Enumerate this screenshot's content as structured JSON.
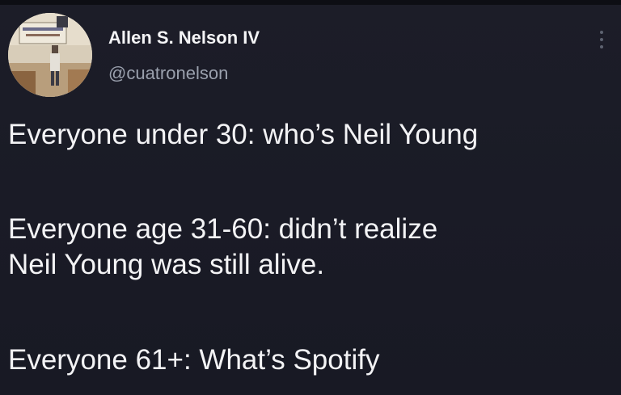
{
  "tweet": {
    "author_name": "Allen S. Nelson IV",
    "author_handle": "@cuatronelson",
    "avatar_icon": "profile-photo",
    "more_icon": "vertical-ellipsis-icon",
    "lines": [
      "Everyone under 30: who’s Neil Young",
      "Everyone age 31-60: didn’t realize",
      "Neil Young was still alive.",
      "Everyone 61+: What’s Spotify"
    ]
  },
  "colors": {
    "background": "#1c1d28",
    "text": "#f3f3f5",
    "handle": "#9aa0ad"
  }
}
